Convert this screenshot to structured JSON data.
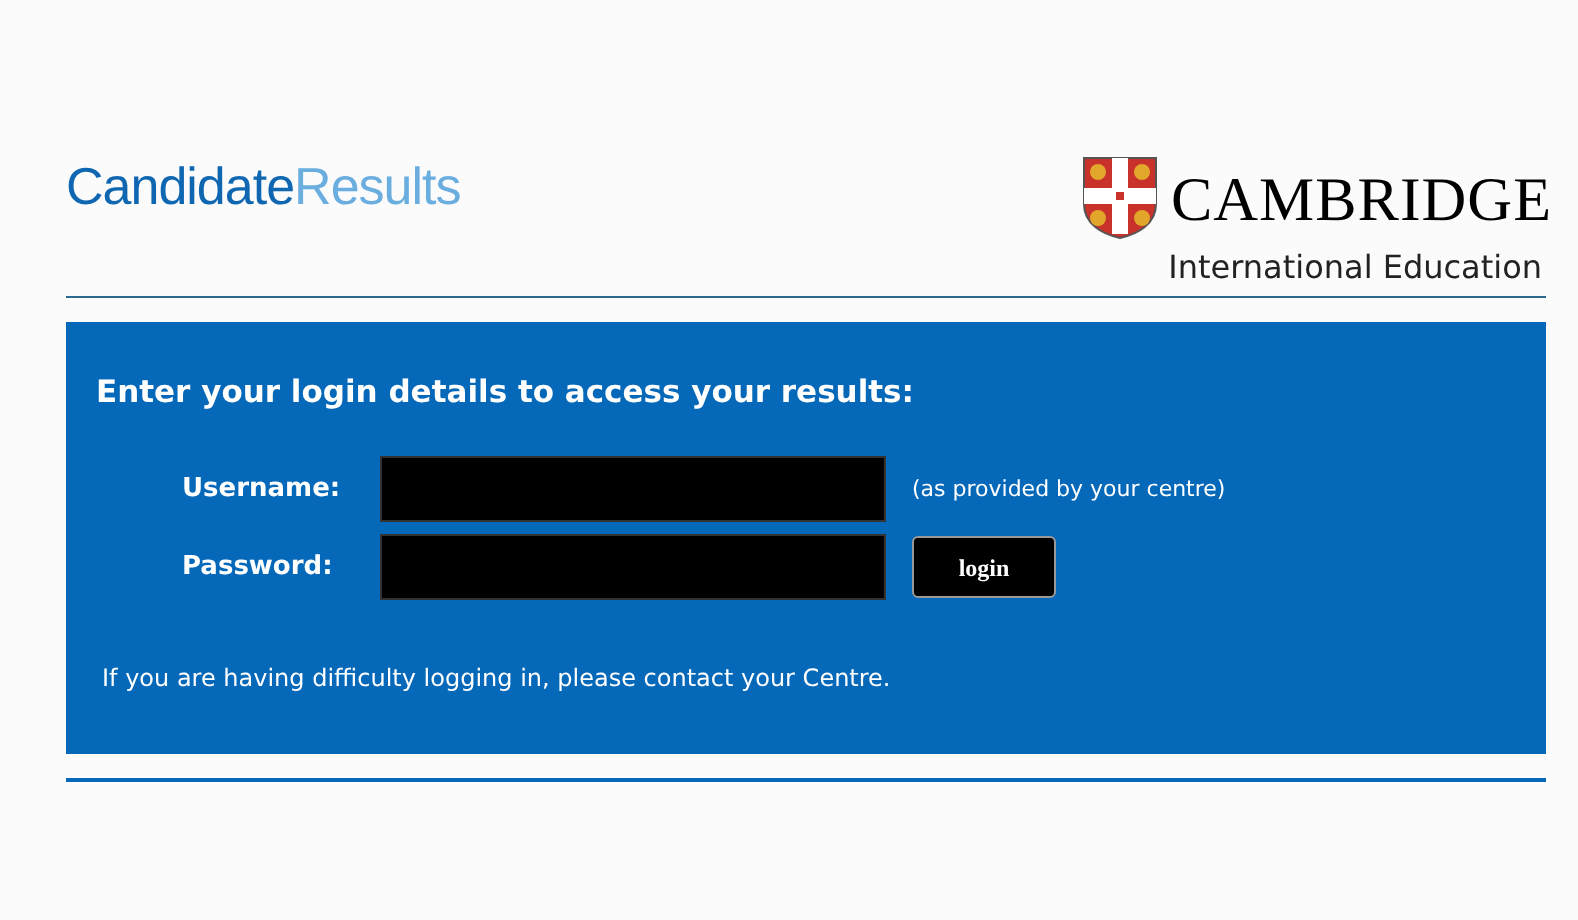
{
  "header": {
    "site_title": {
      "part_1": "Candidate",
      "part_2": "Results"
    },
    "brand": {
      "name": "CAMBRIDGE",
      "subtitle": "International Education"
    }
  },
  "login": {
    "heading": "Enter your login details to access your results:",
    "fields": [
      {
        "label": "Username:",
        "hint": "(as provided by your centre)"
      },
      {
        "label": "Password:"
      }
    ],
    "button": "login",
    "help": "If you are having difficulty logging in, please contact your Centre."
  }
}
